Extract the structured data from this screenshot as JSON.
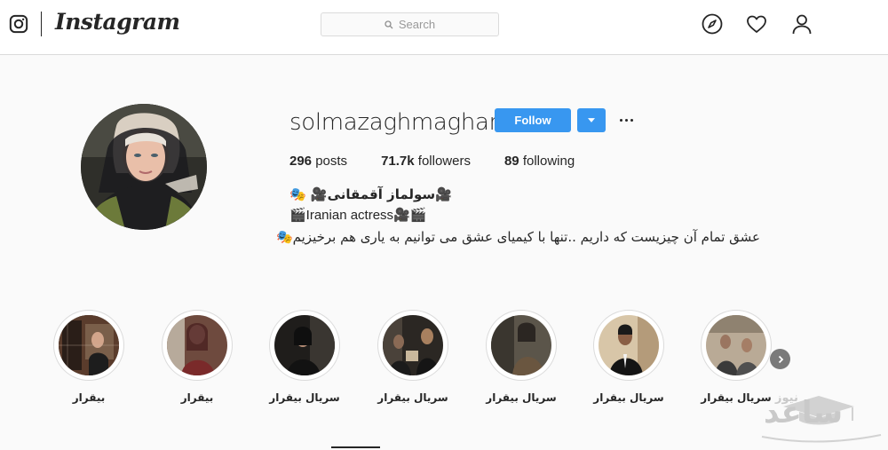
{
  "nav": {
    "brand": "Instagram",
    "search_placeholder": "Search",
    "icons": [
      "instagram-glyph-icon",
      "compass-icon",
      "heart-icon",
      "person-icon"
    ]
  },
  "profile": {
    "username": "solmazaghmaghani",
    "follow_label": "Follow",
    "stats": {
      "posts_value": "296",
      "posts_label": "posts",
      "followers_value": "71.7k",
      "followers_label": "followers",
      "following_value": "89",
      "following_label": "following"
    },
    "bio": {
      "name_line": "🎥سولماز آقمقانی🎥 🎭",
      "line2": "🎬Iranian actress🎥🎬",
      "line3": "عشق تمام آن چیزیست که داریم ..تنها با کیمیای عشق می توانیم به یاری هم برخیزیم🎭"
    }
  },
  "highlights": [
    {
      "label": "بیقرار"
    },
    {
      "label": "بیقرار"
    },
    {
      "label": "سریال بیقرار"
    },
    {
      "label": "سریال بیقرار"
    },
    {
      "label": "سریال بیقرار"
    },
    {
      "label": "سریال بیقرار"
    },
    {
      "label": "سریال بیقرار"
    }
  ],
  "watermark": {
    "brand_big": "ساعد",
    "brand_small": "نیوز"
  },
  "colors": {
    "accent": "#3897f0",
    "border": "#dbdbdb",
    "text": "#262626"
  }
}
